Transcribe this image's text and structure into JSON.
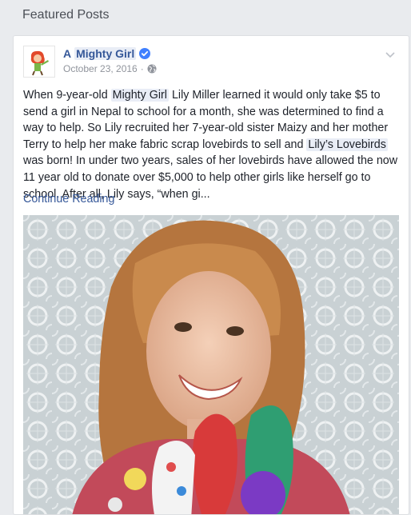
{
  "section": {
    "title": "Featured Posts"
  },
  "post": {
    "page_name_prefix": "A",
    "page_name_highlight": "Mighty Girl",
    "date": "October 23, 2016",
    "date_separator": "·",
    "text": {
      "t1": "When 9-year-old ",
      "h1": "Mighty Girl",
      "t2": " Lily Miller learned it would only take $5 to send a girl in Nepal to school for a month, she was determined to find a way to help. So Lily recruited her 7-year-old sister Maizy and her mother Terry to help her make fabric scrap lovebirds to sell and ",
      "h2": "Lily’s Lovebirds",
      "t3": " was born! In under two years, sales of her lovebirds have allowed the now 11 year old to donate over $5,000 to help other girls like herself go to school. After all, Lily says, “when gi..."
    },
    "continue_label": "Continue Reading",
    "icons": {
      "verified": "verified-badge-icon",
      "audience": "globe-icon",
      "options": "chevron-down-icon"
    }
  },
  "colors": {
    "background": "#e9ebee",
    "link": "#365899",
    "verified": "#4080ff",
    "highlight": "#e9edf6",
    "muted": "#90949c"
  }
}
